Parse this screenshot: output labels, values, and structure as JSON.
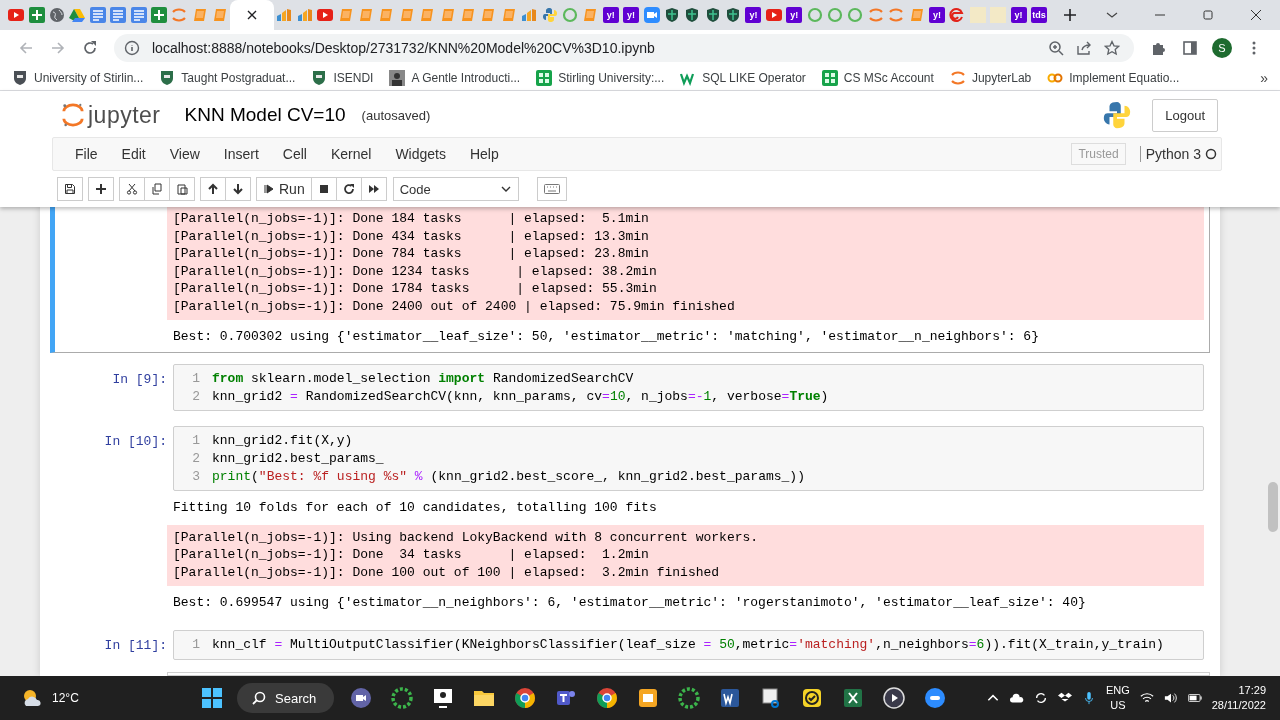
{
  "browser": {
    "tabs": [
      {
        "kind": "play",
        "selected": false
      },
      {
        "kind": "sheet",
        "selected": false
      },
      {
        "kind": "globe",
        "selected": false
      },
      {
        "kind": "drive",
        "selected": false
      },
      {
        "kind": "doc",
        "selected": false
      },
      {
        "kind": "doc",
        "selected": false
      },
      {
        "kind": "doc",
        "selected": false
      },
      {
        "kind": "sheet",
        "selected": false
      },
      {
        "kind": "arcs",
        "selected": false
      },
      {
        "kind": "book",
        "selected": false
      },
      {
        "kind": "book",
        "selected": false
      },
      {
        "selected": true
      },
      {
        "kind": "chart",
        "selected": false
      },
      {
        "kind": "chart",
        "selected": false
      },
      {
        "kind": "play",
        "selected": false
      },
      {
        "kind": "book",
        "selected": false
      },
      {
        "kind": "book",
        "selected": false
      },
      {
        "kind": "book",
        "selected": false
      },
      {
        "kind": "book",
        "selected": false
      },
      {
        "kind": "book",
        "selected": false
      },
      {
        "kind": "book",
        "selected": false
      },
      {
        "kind": "book",
        "selected": false
      },
      {
        "kind": "book",
        "selected": false
      },
      {
        "kind": "book",
        "selected": false
      },
      {
        "kind": "chart",
        "selected": false
      },
      {
        "kind": "snake",
        "selected": false
      },
      {
        "kind": "ring",
        "selected": false
      },
      {
        "kind": "book",
        "selected": false
      },
      {
        "kind": "label",
        "label": "y!",
        "selected": false
      },
      {
        "kind": "label",
        "label": "y!",
        "selected": false
      },
      {
        "kind": "camera",
        "selected": false
      },
      {
        "kind": "shield",
        "selected": false
      },
      {
        "kind": "shield",
        "selected": false
      },
      {
        "kind": "shield",
        "selected": false
      },
      {
        "kind": "shield",
        "selected": false
      },
      {
        "kind": "label",
        "label": "y!",
        "selected": false
      },
      {
        "kind": "play",
        "selected": false
      },
      {
        "kind": "label",
        "label": "y!",
        "selected": false
      },
      {
        "kind": "ring",
        "selected": false
      },
      {
        "kind": "ring",
        "selected": false
      },
      {
        "kind": "ring",
        "selected": false
      },
      {
        "kind": "arcs",
        "selected": false
      },
      {
        "kind": "arcs",
        "selected": false
      },
      {
        "kind": "book",
        "selected": false
      },
      {
        "kind": "label",
        "label": "y!",
        "selected": false
      },
      {
        "kind": "swirl",
        "selected": false
      },
      {
        "kind": "blank",
        "selected": false
      },
      {
        "kind": "blank",
        "selected": false
      },
      {
        "kind": "label",
        "label": "y!",
        "selected": false
      },
      {
        "kind": "label",
        "label": "tds",
        "selected": false
      }
    ],
    "url": "localhost:8888/notebooks/Desktop/2731732/KNN%20Model%20CV%3D10.ipynb",
    "avatar": "S",
    "bookmarks": [
      {
        "kind": "crest",
        "label": "University of Stirlin..."
      },
      {
        "kind": "crest-green",
        "label": "Taught Postgraduat..."
      },
      {
        "kind": "crest-green",
        "label": "ISENDI"
      },
      {
        "kind": "portrait",
        "label": "A Gentle Introducti..."
      },
      {
        "kind": "grid",
        "label": "Stirling University:..."
      },
      {
        "kind": "wave",
        "label": "SQL LIKE Operator"
      },
      {
        "kind": "grid",
        "label": "CS MSc Account"
      },
      {
        "kind": "arcs",
        "label": "JupyterLab"
      },
      {
        "kind": "loops",
        "label": "Implement Equatio..."
      }
    ],
    "bookmarks_more": "»"
  },
  "notebook": {
    "logo": "jupyter",
    "title": "KNN Model CV=10",
    "save_status": "(autosaved)",
    "logout": "Logout",
    "menu": [
      "File",
      "Edit",
      "View",
      "Insert",
      "Cell",
      "Kernel",
      "Widgets",
      "Help"
    ],
    "trusted": "Trusted",
    "kernel": "Python 3",
    "toolbar": [
      {
        "kind": "save"
      },
      {
        "kind": "plus"
      },
      {
        "kind": "cut"
      },
      {
        "kind": "copy"
      },
      {
        "kind": "paste"
      },
      {
        "kind": "up"
      },
      {
        "kind": "down"
      },
      {
        "kind": "run",
        "label": "Run"
      },
      {
        "kind": "stop"
      },
      {
        "kind": "restart"
      },
      {
        "kind": "fast-forward"
      }
    ],
    "cell_type": "Code",
    "cells": [
      {
        "selected": true,
        "outputs": [
          {
            "kind": "stderr",
            "lines": [
              "[Parallel(n_jobs=-1)]: Done 184 tasks      | elapsed:  5.1min",
              "[Parallel(n_jobs=-1)]: Done 434 tasks      | elapsed: 13.3min",
              "[Parallel(n_jobs=-1)]: Done 784 tasks      | elapsed: 23.8min",
              "[Parallel(n_jobs=-1)]: Done 1234 tasks      | elapsed: 38.2min",
              "[Parallel(n_jobs=-1)]: Done 1784 tasks      | elapsed: 55.3min",
              "[Parallel(n_jobs=-1)]: Done 2400 out of 2400 | elapsed: 75.9min finished"
            ]
          },
          {
            "kind": "stdout",
            "lines": [
              "Best: 0.700302 using {'estimator__leaf_size': 50, 'estimator__metric': 'matching', 'estimator__n_neighbors': 6}"
            ]
          }
        ]
      },
      {
        "selected": false,
        "prompt": "In [9]:",
        "lines": [
          {
            "n": "1",
            "tokens": [
              {
                "t": "from",
                "kind": "kw"
              },
              {
                "t": " sklearn.model_selection ",
                "kind": "p"
              },
              {
                "t": "import",
                "kind": "kw"
              },
              {
                "t": " RandomizedSearchCV",
                "kind": "p"
              }
            ]
          },
          {
            "n": "2",
            "tokens": [
              {
                "t": "knn_grid2 ",
                "kind": "p"
              },
              {
                "t": "=",
                "kind": "op"
              },
              {
                "t": " RandomizedSearchCV(knn, knn_params, cv",
                "kind": "p"
              },
              {
                "t": "=",
                "kind": "op"
              },
              {
                "t": "10",
                "kind": "num"
              },
              {
                "t": ", n_jobs",
                "kind": "p"
              },
              {
                "t": "=-",
                "kind": "op"
              },
              {
                "t": "1",
                "kind": "num"
              },
              {
                "t": ", verbose",
                "kind": "p"
              },
              {
                "t": "=",
                "kind": "op"
              },
              {
                "t": "True",
                "kind": "kw"
              },
              {
                "t": ")",
                "kind": "p"
              }
            ]
          }
        ]
      },
      {
        "selected": false,
        "prompt": "In [10]:",
        "lines": [
          {
            "n": "1",
            "tokens": [
              {
                "t": "knn_grid2.fit(X,y)",
                "kind": "p"
              }
            ]
          },
          {
            "n": "2",
            "tokens": [
              {
                "t": "knn_grid2.best_params_",
                "kind": "p"
              }
            ]
          },
          {
            "n": "3",
            "tokens": [
              {
                "t": "print",
                "kind": "bi"
              },
              {
                "t": "(",
                "kind": "p"
              },
              {
                "t": "\"Best: %f using %s\" ",
                "kind": "str"
              },
              {
                "t": "%",
                "kind": "op"
              },
              {
                "t": " (knn_grid2.best_score_, knn_grid2.best_params_))",
                "kind": "p"
              }
            ]
          }
        ],
        "outputs": [
          {
            "kind": "stdout",
            "lines": [
              "Fitting 10 folds for each of 10 candidates, totalling 100 fits"
            ]
          },
          {
            "kind": "stderr",
            "lines": [
              "[Parallel(n_jobs=-1)]: Using backend LokyBackend with 8 concurrent workers.",
              "[Parallel(n_jobs=-1)]: Done  34 tasks      | elapsed:  1.2min",
              "[Parallel(n_jobs=-1)]: Done 100 out of 100 | elapsed:  3.2min finished"
            ]
          },
          {
            "kind": "stdout",
            "lines": [
              "Best: 0.699547 using {'estimator__n_neighbors': 6, 'estimator__metric': 'rogerstanimoto', 'estimator__leaf_size': 40}"
            ]
          }
        ]
      },
      {
        "selected": false,
        "prompt": "In [11]:",
        "lines": [
          {
            "n": "1",
            "tokens": [
              {
                "t": "knn_clf ",
                "kind": "p"
              },
              {
                "t": "=",
                "kind": "op"
              },
              {
                "t": " MultiOutputClassifier(KNeighborsClassifier(leaf_size ",
                "kind": "p"
              },
              {
                "t": "= ",
                "kind": "op"
              },
              {
                "t": "50",
                "kind": "num"
              },
              {
                "t": ",metric",
                "kind": "p"
              },
              {
                "t": "=",
                "kind": "op"
              },
              {
                "t": "'matching'",
                "kind": "str"
              },
              {
                "t": ",n_neighbors",
                "kind": "p"
              },
              {
                "t": "=",
                "kind": "op"
              },
              {
                "t": "6",
                "kind": "num"
              },
              {
                "t": ")).fit(X_train,y_train)",
                "kind": "p"
              }
            ]
          }
        ]
      }
    ]
  },
  "taskbar": {
    "weather": "12°C",
    "search": "Search",
    "apps": [
      {
        "kind": "chat"
      },
      {
        "kind": "ring"
      },
      {
        "kind": "screen"
      },
      {
        "kind": "folder"
      },
      {
        "kind": "chrome"
      },
      {
        "kind": "teams"
      },
      {
        "kind": "chrome"
      },
      {
        "kind": "slides"
      },
      {
        "kind": "ring"
      },
      {
        "kind": "word"
      },
      {
        "kind": "snip"
      },
      {
        "kind": "check"
      },
      {
        "kind": "excel"
      },
      {
        "kind": "play"
      },
      {
        "kind": "zoom"
      }
    ],
    "language": "ENG",
    "region": "US",
    "time": "17:29",
    "date": "28/11/2022"
  }
}
